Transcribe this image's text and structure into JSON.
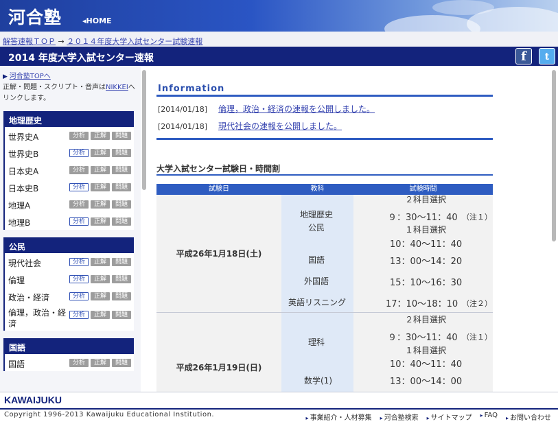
{
  "header": {
    "logo": "河合塾",
    "home": "◂HOME"
  },
  "breadcrumb": {
    "link1": "解答速報ＴＯＰ",
    "sep": " → ",
    "link2": "２０１４年度大学入試センター試験速報"
  },
  "title_bar": {
    "title": "2014 年度大学入試センター速報",
    "facebook": "f",
    "twitter": "t"
  },
  "sidebar": {
    "top_link": "河合塾TOPへ",
    "note_before": "正解・問題・スクリプト・音声は",
    "note_link": "NIKKEI",
    "note_after": "へリンクします。",
    "button_labels": {
      "analysis": "分析",
      "answer": "正解",
      "question": "問題"
    },
    "categories": [
      {
        "name": "地理歴史",
        "subjects": [
          {
            "label": "世界史A",
            "analysis_active": false
          },
          {
            "label": "世界史B",
            "analysis_active": true
          },
          {
            "label": "日本史A",
            "analysis_active": false
          },
          {
            "label": "日本史B",
            "analysis_active": true
          },
          {
            "label": "地理A",
            "analysis_active": false
          },
          {
            "label": "地理B",
            "analysis_active": true
          }
        ]
      },
      {
        "name": "公民",
        "subjects": [
          {
            "label": "現代社会",
            "analysis_active": true
          },
          {
            "label": "倫理",
            "analysis_active": true
          },
          {
            "label": "政治・経済",
            "analysis_active": true
          },
          {
            "label": "倫理，政治・経済",
            "analysis_active": true
          }
        ]
      },
      {
        "name": "国語",
        "subjects": [
          {
            "label": "国語",
            "analysis_active": false
          }
        ]
      }
    ]
  },
  "main": {
    "info_title": "Information",
    "news": [
      {
        "date": "[2014/01/18]",
        "text": "倫理，政治・経済の速報を公開しました。"
      },
      {
        "date": "[2014/01/18]",
        "text": "現代社会の速報を公開しました。"
      }
    ],
    "timetable_title": "大学入試センター試験日・時間割",
    "columns": [
      "試験日",
      "教科",
      "試験時間"
    ],
    "day1": {
      "date": "平成26年1月18日(土)",
      "subj_geo": "地理歴史",
      "subj_civ": "公民",
      "subj_jp": "国語",
      "subj_fl": "外国語",
      "subj_listen": "英語リスニング",
      "t_two": "２科目選択",
      "t_two_time": "９：30〜11：40",
      "note1": "（注１）",
      "t_one": "１科目選択",
      "t_one_time": "10：40〜11：40",
      "t_jp": "13：00〜14：20",
      "t_fl": "15：10〜16：30",
      "t_listen": "17：10〜18：10",
      "note2": "（注２）"
    },
    "day2": {
      "date": "平成26年1月19日(日)",
      "subj_sci": "理科",
      "subj_math": "数学(1)",
      "t_two": "２科目選択",
      "t_two_time": "９：30〜11：40",
      "note1": "（注１）",
      "t_one": "１科目選択",
      "t_one_time": "10：40〜11：40",
      "t_math": "13：00〜14：00"
    }
  },
  "footer": {
    "logo": "KAWAIJUKU",
    "copyright": "Copyright 1996-2013 Kawaijuku Educational Institution.",
    "links": [
      "事業紹介・人材募集",
      "河合塾検索",
      "サイトマップ",
      "FAQ",
      "お問い合わせ"
    ]
  }
}
